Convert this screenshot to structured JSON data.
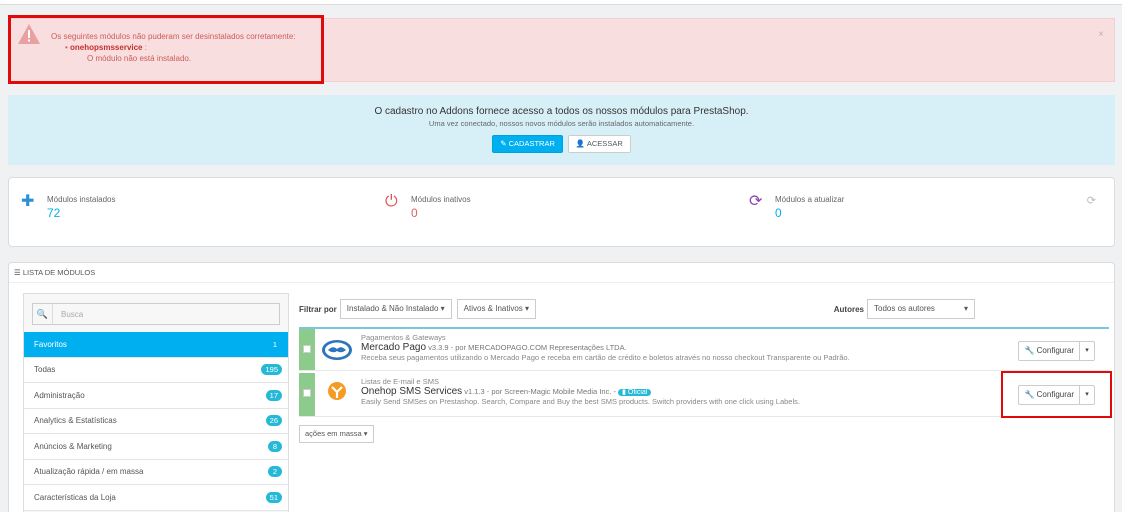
{
  "alert": {
    "line1": "Os seguintes módulos não puderam ser desinstalados corretamente:",
    "module_name": "onehopsmsservice",
    "suffix": " :",
    "detail": "O módulo não está instalado.",
    "close": "×"
  },
  "info": {
    "heading": "O cadastro no Addons fornece acesso a todos os nossos módulos para PrestaShop.",
    "subheading": "Uma vez conectado, nossos novos módulos serão instalados automaticamente.",
    "register_label": "CADASTRAR",
    "login_label": "ACESSAR"
  },
  "stats": [
    {
      "label": "Módulos instalados",
      "value": "72",
      "icon": "puzzle-icon"
    },
    {
      "label": "Módulos inativos",
      "value": "0",
      "icon": "power-icon"
    },
    {
      "label": "Módulos a atualizar",
      "value": "0",
      "icon": "refresh-icon"
    }
  ],
  "panel": {
    "title": "LISTA DE MÓDULOS",
    "search_placeholder": "Busca",
    "categories": [
      {
        "label": "Favoritos",
        "count": "1"
      },
      {
        "label": "Todas",
        "count": "195"
      },
      {
        "label": "Administração",
        "count": "17"
      },
      {
        "label": "Analytics & Estatísticas",
        "count": "26"
      },
      {
        "label": "Anúncios & Marketing",
        "count": "8"
      },
      {
        "label": "Atualização rápida / em massa",
        "count": "2"
      },
      {
        "label": "Características da Loja",
        "count": "51"
      }
    ],
    "filter_label": "Filtrar por",
    "filter_install": "Instalado & Não Instalado",
    "filter_active": "Ativos & Inativos",
    "authors_label": "Autores",
    "authors_value": "Todos os autores",
    "bulk_label": "ações em massa"
  },
  "modules": [
    {
      "category": "Pagamentos & Gateways",
      "name": "Mercado Pago",
      "version": " v3.3.9 - por MERCADOPAGO.COM Representações LTDA.",
      "description": "Receba seus pagamentos utilizando o Mercado Pago e receba em cartão de crédito e boletos através no nosso checkout Transparente ou Padrão.",
      "configure_label": "Configurar"
    },
    {
      "category": "Listas de E-mail e SMS",
      "name": "Onehop SMS Services",
      "version": " v1.1.3 - por Screen-Magic Mobile Media Inc. - ",
      "badge": "Oficial",
      "description": "Easily Send SMSes on Prestashop. Search, Compare and Buy the best SMS products. Switch providers with one click using Labels.",
      "configure_label": "Configurar"
    }
  ],
  "colors": {
    "accent": "#00aff0",
    "alert_bg": "#f9dedf",
    "info_bg": "#d7f0f7",
    "highlight": "#e10a0a"
  }
}
